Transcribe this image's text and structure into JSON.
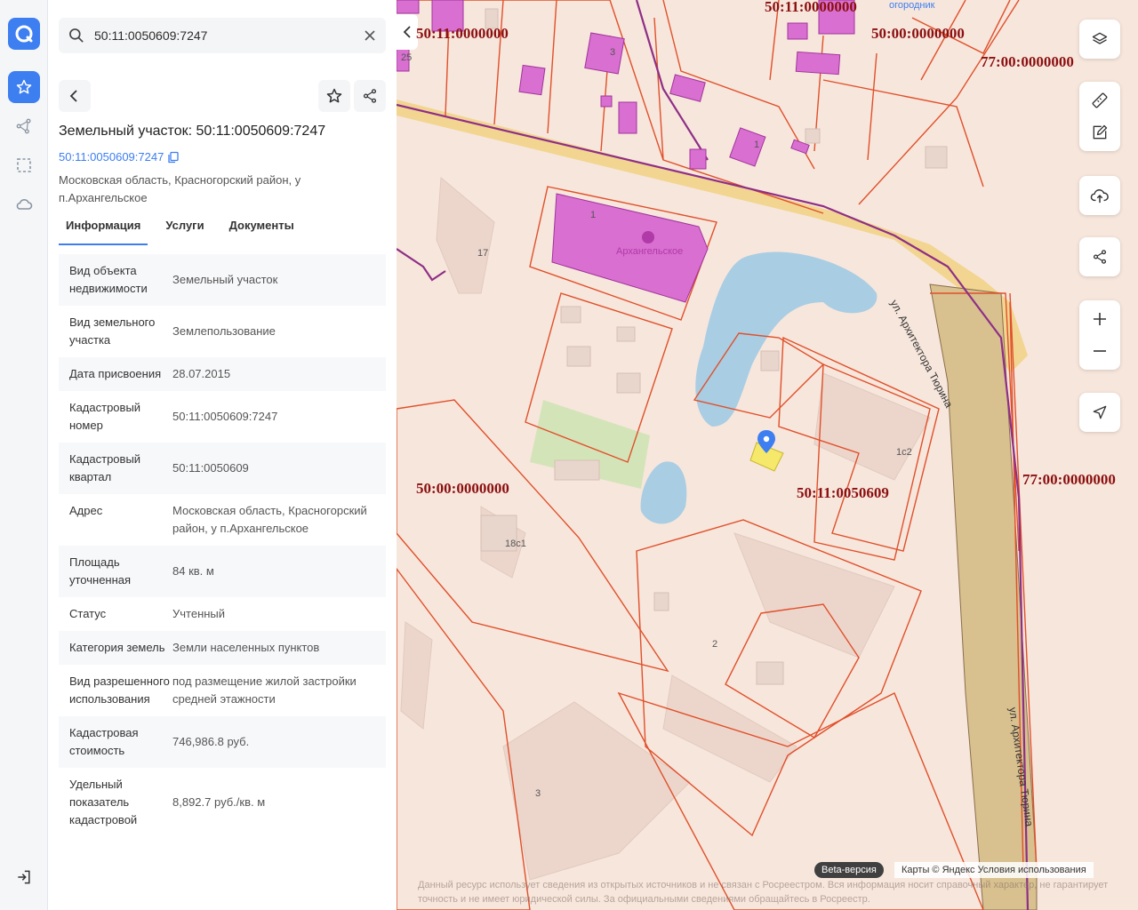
{
  "search": {
    "value": "50:11:0050609:7247",
    "placeholder": ""
  },
  "object": {
    "title": "Земельный участок: 50:11:0050609:7247",
    "cad_number_link": "50:11:0050609:7247",
    "address": "Московская область, Красногорский район, у п.Архангельское"
  },
  "tabs": [
    {
      "label": "Информация",
      "active": true
    },
    {
      "label": "Услуги",
      "active": false
    },
    {
      "label": "Документы",
      "active": false
    }
  ],
  "info_rows": [
    {
      "key": "Вид объекта недвижимости",
      "value": "Земельный участок"
    },
    {
      "key": "Вид земельного участка",
      "value": "Землепользование"
    },
    {
      "key": "Дата присвоения",
      "value": "28.07.2015"
    },
    {
      "key": "Кадастровый номер",
      "value": "50:11:0050609:7247"
    },
    {
      "key": "Кадастровый квартал",
      "value": "50:11:0050609"
    },
    {
      "key": "Адрес",
      "value": "Московская область, Красногорский район, у п.Архангельское"
    },
    {
      "key": "Площадь уточненная",
      "value": "84 кв. м"
    },
    {
      "key": "Статус",
      "value": "Учтенный"
    },
    {
      "key": "Категория земель",
      "value": "Земли населенных пунктов"
    },
    {
      "key": "Вид разрешенного использования",
      "value": "под размещение жилой застройки средней этажности"
    },
    {
      "key": "Кадастровая стоимость",
      "value": "746,986.8 руб."
    },
    {
      "key": "Удельный показатель кадастровой",
      "value": "8,892.7 руб./кв. м"
    }
  ],
  "map": {
    "zone_labels": {
      "z1": "50:11:0000000",
      "z2": "50:11:0000000",
      "z3": "50:00:0000000",
      "z4": "77:00:0000000",
      "z5": "50:00:0000000",
      "z6": "50:11:0050609",
      "z7": "77:00:0000000"
    },
    "poi_label": "Архангельское",
    "top_label": "огородник",
    "street_1": "ул. Архитектора Тюрина",
    "street_2": "ул. Архитектора Тюрина",
    "house_numbers": {
      "h1": "17",
      "h2": "18с1",
      "h3": "1с2",
      "h4": "2",
      "h5": "3",
      "h6": "1",
      "h7": "3",
      "h8": "1",
      "h9": "25"
    },
    "beta_badge": "Beta-версия",
    "copyright": "Карты © Яндекс   Условия использования",
    "disclaimer": "Данный ресурс использует сведения из открытых источников и не связан с Росреестром. Вся информация носит справочный характер, не гарантирует точность и не имеет юридической силы. За официальными сведениями обращайтесь в Росреестр."
  },
  "colors": {
    "accent": "#3d7ef1",
    "parcel_border": "#e0502a",
    "building_fill": "#d96fd0",
    "zone_label": "#8b0f0f",
    "water": "#a9cde3",
    "selected_parcel": "#f5e86a"
  },
  "icons": {
    "logo": "app-logo-icon",
    "favorites": "star-icon",
    "routes": "nodes-icon",
    "selection": "dashed-square-icon",
    "cloud": "cloud-icon",
    "logout": "logout-icon"
  }
}
